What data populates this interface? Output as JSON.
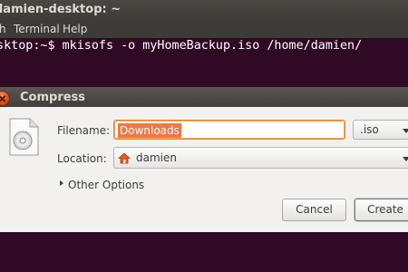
{
  "terminal": {
    "title": "damien-desktop: ~",
    "menu": [
      "h",
      "Terminal",
      "Help"
    ],
    "command_line": "esktop:~$ mkisofs -o myHomeBackup.iso /home/damien/"
  },
  "dialog": {
    "title": "Compress",
    "filename_label": "Filename:",
    "filename_value": "Downloads",
    "extension_value": ".iso",
    "location_label": "Location:",
    "location_value": "damien",
    "other_options_label": "Other Options",
    "cancel_label": "Cancel",
    "create_label": "Create"
  },
  "colors": {
    "terminal_bg": "#300a24",
    "selection": "#f07746",
    "close_button": "#df4a16",
    "location_icon": "#e05a2a"
  },
  "icons": {
    "document": "disc-document-icon",
    "location": "home-folder-icon",
    "close": "close-icon",
    "expander": "triangle-right-icon",
    "dropdown": "chevron-down-icon"
  }
}
